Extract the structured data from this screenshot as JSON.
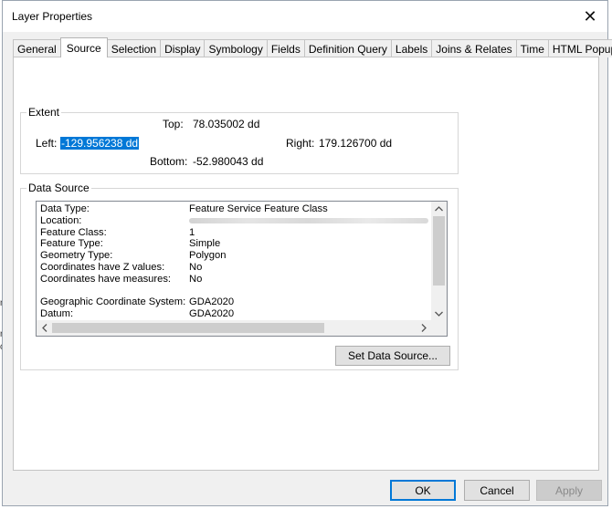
{
  "background": {
    "fragments": [
      "n",
      "r",
      "c"
    ]
  },
  "dialog": {
    "title": "Layer Properties",
    "close_glyph": "✕"
  },
  "tabs": [
    {
      "label": "General",
      "active": false
    },
    {
      "label": "Source",
      "active": true
    },
    {
      "label": "Selection",
      "active": false
    },
    {
      "label": "Display",
      "active": false
    },
    {
      "label": "Symbology",
      "active": false
    },
    {
      "label": "Fields",
      "active": false
    },
    {
      "label": "Definition Query",
      "active": false
    },
    {
      "label": "Labels",
      "active": false
    },
    {
      "label": "Joins & Relates",
      "active": false
    },
    {
      "label": "Time",
      "active": false
    },
    {
      "label": "HTML Popup",
      "active": false
    }
  ],
  "extent": {
    "group_label": "Extent",
    "top_label": "Top:",
    "top_value": "78.035002 dd",
    "left_label": "Left:",
    "left_value": "-129.956238 dd",
    "right_label": "Right:",
    "right_value": "179.126700 dd",
    "bottom_label": "Bottom:",
    "bottom_value": "-52.980043 dd"
  },
  "data_source": {
    "group_label": "Data Source",
    "properties": [
      {
        "key": "Data Type:",
        "value": "Feature Service Feature Class"
      },
      {
        "key": "Location:",
        "value": "",
        "blurred": true
      },
      {
        "key": "Feature Class:",
        "value": "1"
      },
      {
        "key": "Feature Type:",
        "value": "Simple"
      },
      {
        "key": "Geometry Type:",
        "value": "Polygon"
      },
      {
        "key": "Coordinates have Z values:",
        "value": "No"
      },
      {
        "key": "Coordinates have measures:",
        "value": "No"
      },
      {
        "key": "",
        "value": ""
      },
      {
        "key": "Geographic Coordinate System:",
        "value": "GDA2020"
      },
      {
        "key": "Datum:",
        "value": "GDA2020"
      }
    ],
    "set_source_button": "Set Data Source..."
  },
  "footer": {
    "ok": "OK",
    "cancel": "Cancel",
    "apply": "Apply"
  }
}
